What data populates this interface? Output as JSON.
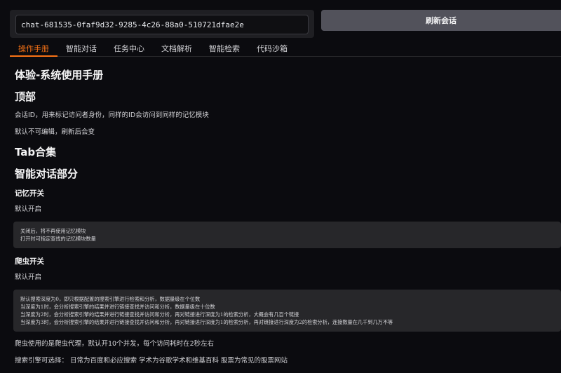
{
  "session": {
    "id_value": "chat-681535-0faf9d32-9285-4c26-88a0-510721dfae2e",
    "refresh_label": "刷新会话"
  },
  "tabs": [
    {
      "label": "操作手册",
      "active": true
    },
    {
      "label": "智能对话",
      "active": false
    },
    {
      "label": "任务中心",
      "active": false
    },
    {
      "label": "文档解析",
      "active": false
    },
    {
      "label": "智能检索",
      "active": false
    },
    {
      "label": "代码沙箱",
      "active": false
    }
  ],
  "manual": {
    "title": "体验-系统使用手册",
    "top_heading": "顶部",
    "top_desc_1": "会话ID，用来标记访问者身份，同样的ID会访问到同样的记忆模块",
    "top_desc_2": "默认不可编辑，刷新后会变",
    "tab_heading": "Tab合集",
    "chat_heading": "智能对话部分",
    "memory": {
      "heading": "记忆开关",
      "default": "默认开启",
      "code_lines": [
        "关闭后，将不再使用记忆模块",
        "打开时可指定查找的记忆模块数量"
      ]
    },
    "crawler": {
      "heading": "爬虫开关",
      "default": "默认开启",
      "code_lines": [
        "默认搜索深度为0，即只根据配置的搜索引擎进行检索和分析，数据量级在个位数",
        "当深度为1时，会分析搜索引擎的结果并进行链接查找并访问和分析，数据量级在十位数",
        "当深度为2时，会分析搜索引擎的结果并进行链接查找并访问和分析，再对链接进行深度为1的检索分析，大概会有几百个链接",
        "当深度为3时，会分析搜索引擎的结果并进行链接查找并访问和分析，再对链接进行深度为1的检索分析，再对链接进行深度为2的检索分析，连接数量在几千到几万不等"
      ],
      "proxy_note": "爬虫使用的是爬虫代理，默认开10个并发，每个访问耗时在2秒左右",
      "engine_note": "搜索引擎可选择： 日常为百度和必应搜索 学术为谷歌学术和维基百科 股票为常见的股票网站"
    }
  },
  "colors": {
    "accent": "#f97316",
    "background": "#0b0b0f",
    "panel": "#1f1f23",
    "button": "#52525b"
  }
}
